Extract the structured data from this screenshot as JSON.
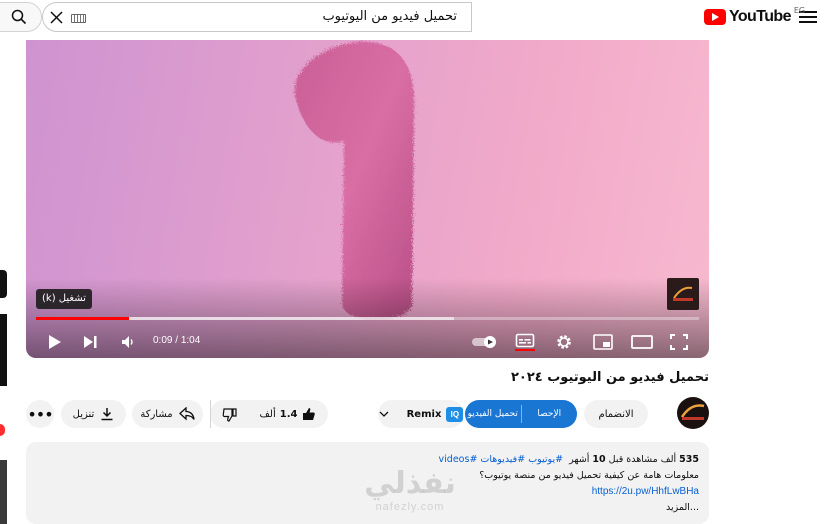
{
  "header": {
    "logo_text": "YouTube",
    "logo_country": "EG",
    "search_value": "تحميل فيديو من اليوتيوب"
  },
  "player": {
    "tooltip": "تشغيل (k)",
    "current_time": "0:09",
    "time_separator": " / ",
    "duration": "1:04",
    "progress_fraction": 0.14,
    "buffered_fraction": 0.63
  },
  "video": {
    "title": "تحميل فيديو من اليوتيوب ٢٠٢٤"
  },
  "actions": {
    "download_label": "تنزيل",
    "share_label": "مشاركة",
    "like_count": "1.4",
    "like_unit": "ألف",
    "remix_label": "Remix",
    "blue_left_label": "تحميل الفيديو",
    "blue_right_label": "الإحصا",
    "join_label": "الانضمام"
  },
  "description": {
    "views": "535",
    "views_unit": "ألف مشاهدة",
    "time_prefix": "قبل",
    "time_value": "10",
    "time_unit": "أشهر",
    "hashtags": "#يوتيوب #فيديوهات #videos",
    "line2": "معلومات هامة عن كيفية تحميل فيديو من منصة يوتيوب؟",
    "link": "https://2u.pw/HhfLwBHa",
    "more": "...المزيد"
  },
  "watermark": {
    "site_name": "نفذلي",
    "site_url": "nafezly.com"
  },
  "colors": {
    "accent_red": "#ff0000",
    "button_blue": "#1976d2",
    "link_blue": "#065fd4"
  }
}
